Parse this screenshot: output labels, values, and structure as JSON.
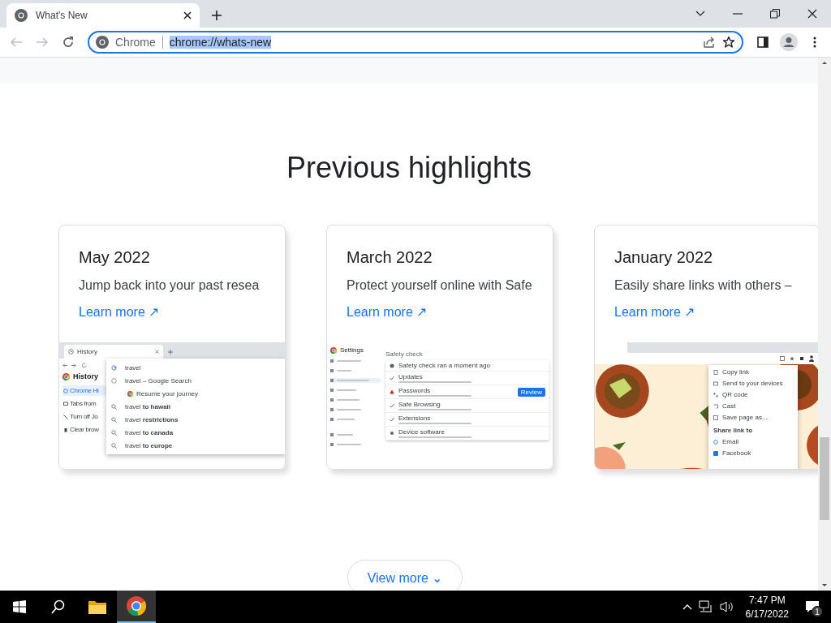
{
  "browser": {
    "tab": {
      "title": "What's New",
      "selected": true
    },
    "omnibox": {
      "scheme_label": "Chrome",
      "url": "chrome://whats-new",
      "url_selected": true
    }
  },
  "page": {
    "heading": "Previous highlights",
    "cards": [
      {
        "title": "May 2022",
        "description": "Jump back into your past resea",
        "link": "Learn more ↗",
        "preview": {
          "kind": "history",
          "tab_title": "History",
          "side_heading": "History",
          "side_items": [
            {
              "text": "Chrome Hi",
              "selected": true
            },
            {
              "text": "Tabs from",
              "selected": false
            },
            {
              "text": "Turn off Jo",
              "selected": false
            },
            {
              "text": "Clear brow",
              "selected": false
            }
          ],
          "query": "travel",
          "history_row": "travel – Google Search",
          "journey": "Resume your journey",
          "suggestions": [
            "travel **to hawaii**",
            "travel **restrictions**",
            "travel **to canada**",
            "travel **to europe**"
          ]
        }
      },
      {
        "title": "March 2022",
        "description": "Protect yourself online with Safe",
        "link": "Learn more ↗",
        "preview": {
          "kind": "settings",
          "app_title": "Settings",
          "section": "Safety check",
          "rows": [
            {
              "title": "Safety check ran a moment ago",
              "kind": "header"
            },
            {
              "title": "Updates",
              "kind": "ok"
            },
            {
              "title": "Passwords",
              "kind": "warn",
              "action": "Review"
            },
            {
              "title": "Safe Browsing",
              "kind": "ok"
            },
            {
              "title": "Extensions",
              "kind": "ok"
            },
            {
              "title": "Device software",
              "kind": "info"
            }
          ]
        }
      },
      {
        "title": "January 2022",
        "description": "Easily share links with others –",
        "link": "Learn more ↗",
        "preview": {
          "kind": "share",
          "menu": [
            "Copy link",
            "Send to your devices",
            "QR code",
            "Cast",
            "Save page as..."
          ],
          "share_heading": "Share link to",
          "share_targets": [
            "Email",
            "Facebook"
          ]
        }
      }
    ],
    "view_more": "View more ⌄"
  },
  "taskbar": {
    "time": "7:47 PM",
    "date": "6/17/2022",
    "notifications": "1"
  }
}
